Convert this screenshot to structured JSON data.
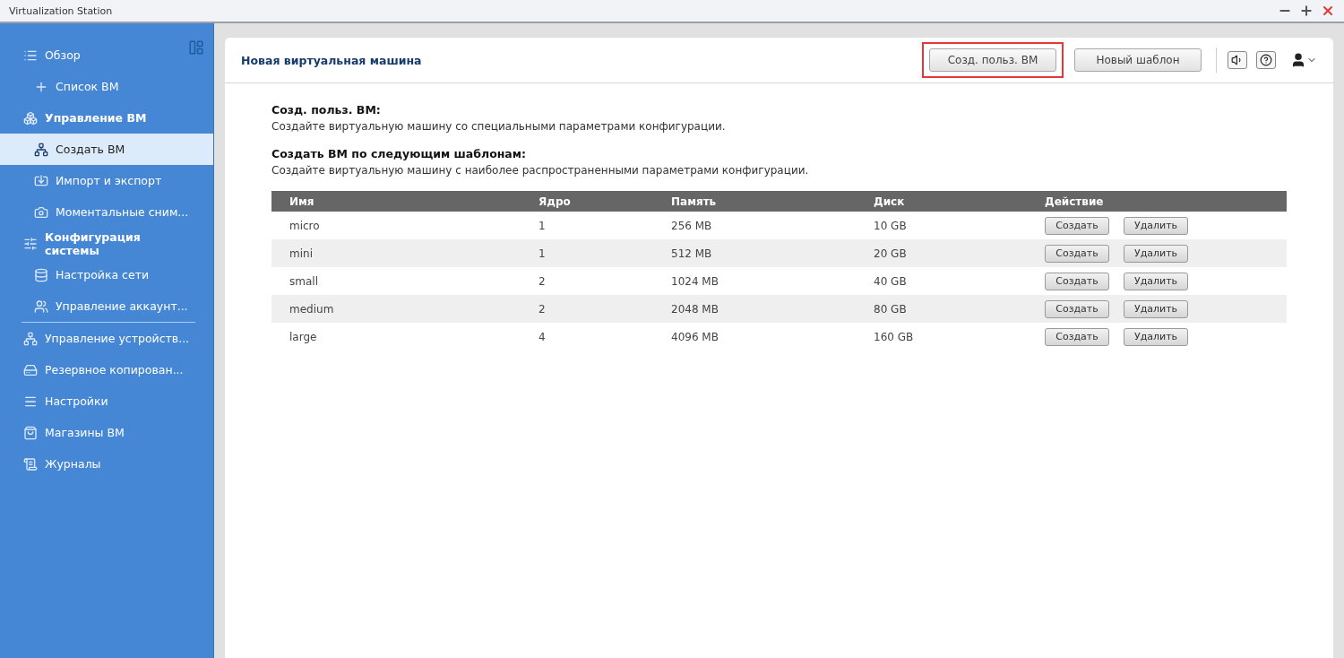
{
  "window": {
    "title": "Virtualization Station"
  },
  "sidebar": {
    "items": [
      {
        "kind": "link",
        "label": "Обзор",
        "selected": false,
        "children": [
          {
            "kind": "link",
            "label": "Список ВМ",
            "selected": false
          }
        ]
      },
      {
        "kind": "group",
        "label": "Управление ВМ",
        "selected": false,
        "children": [
          {
            "kind": "link",
            "label": "Создать ВМ",
            "selected": true
          },
          {
            "kind": "link",
            "label": "Импорт и экспорт",
            "selected": false
          },
          {
            "kind": "link",
            "label": "Моментальные сним...",
            "selected": false
          }
        ]
      },
      {
        "kind": "group",
        "label": "Конфигурация системы",
        "selected": false,
        "children": [
          {
            "kind": "link",
            "label": "Настройка сети",
            "selected": false
          },
          {
            "kind": "link",
            "label": "Управление аккаунт...",
            "selected": false
          }
        ]
      },
      {
        "kind": "link",
        "label": "Управление устройств...",
        "selected": false
      },
      {
        "kind": "link",
        "label": "Резервное копирован...",
        "selected": false
      },
      {
        "kind": "link",
        "label": "Настройки",
        "selected": false
      },
      {
        "kind": "link",
        "label": "Магазины ВМ",
        "selected": false
      },
      {
        "kind": "link",
        "label": "Журналы",
        "selected": false
      }
    ]
  },
  "panel": {
    "title": "Новая виртуальная машина",
    "buttons": [
      {
        "label": "Созд. польз. ВМ",
        "highlighted": true
      },
      {
        "label": "Новый шаблон",
        "highlighted": false
      }
    ],
    "sections": [
      {
        "heading": "Созд. польз. ВМ:",
        "text": "Создайте виртуальную машину со специальными параметрами конфигурации."
      },
      {
        "heading": "Создать ВМ по следующим шаблонам:",
        "text": "Создайте виртуальную машину с наиболее распространенными параметрами конфигурации."
      }
    ],
    "table": {
      "columns": [
        "Имя",
        "Ядро",
        "Память",
        "Диск",
        "Действие"
      ],
      "rows": [
        {
          "cells": [
            "micro",
            "1",
            "256 MB",
            "10 GB"
          ],
          "actions": [
            "Создать",
            "Удалить"
          ]
        },
        {
          "cells": [
            "mini",
            "1",
            "512 MB",
            "20 GB"
          ],
          "actions": [
            "Создать",
            "Удалить"
          ]
        },
        {
          "cells": [
            "small",
            "2",
            "1024 MB",
            "40 GB"
          ],
          "actions": [
            "Создать",
            "Удалить"
          ]
        },
        {
          "cells": [
            "medium",
            "2",
            "2048 MB",
            "80 GB"
          ],
          "actions": [
            "Создать",
            "Удалить"
          ]
        },
        {
          "cells": [
            "large",
            "4",
            "4096 MB",
            "160 GB"
          ],
          "actions": [
            "Создать",
            "Удалить"
          ]
        }
      ]
    }
  }
}
